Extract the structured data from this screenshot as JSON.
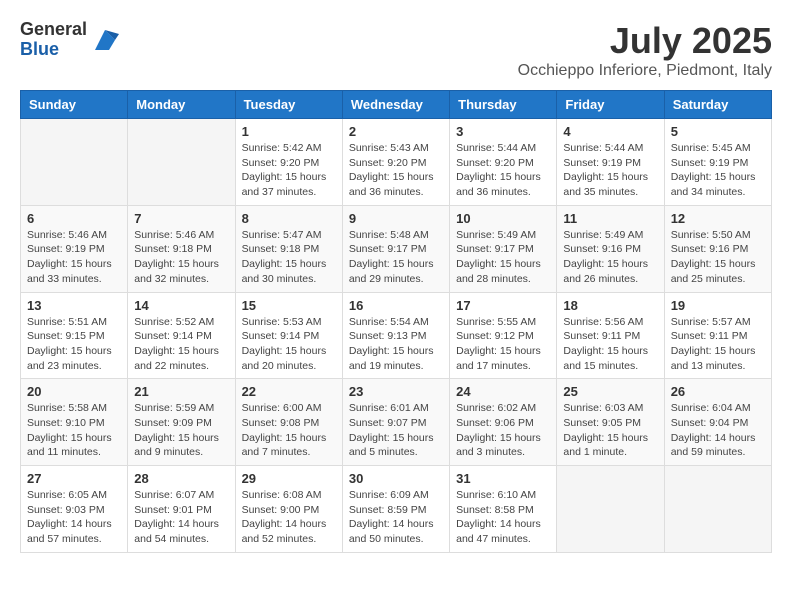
{
  "header": {
    "logo": {
      "general": "General",
      "blue": "Blue"
    },
    "title": "July 2025",
    "location": "Occhieppo Inferiore, Piedmont, Italy"
  },
  "calendar": {
    "days_of_week": [
      "Sunday",
      "Monday",
      "Tuesday",
      "Wednesday",
      "Thursday",
      "Friday",
      "Saturday"
    ],
    "weeks": [
      [
        {
          "day": "",
          "info": ""
        },
        {
          "day": "",
          "info": ""
        },
        {
          "day": "1",
          "info": "Sunrise: 5:42 AM\nSunset: 9:20 PM\nDaylight: 15 hours\nand 37 minutes."
        },
        {
          "day": "2",
          "info": "Sunrise: 5:43 AM\nSunset: 9:20 PM\nDaylight: 15 hours\nand 36 minutes."
        },
        {
          "day": "3",
          "info": "Sunrise: 5:44 AM\nSunset: 9:20 PM\nDaylight: 15 hours\nand 36 minutes."
        },
        {
          "day": "4",
          "info": "Sunrise: 5:44 AM\nSunset: 9:19 PM\nDaylight: 15 hours\nand 35 minutes."
        },
        {
          "day": "5",
          "info": "Sunrise: 5:45 AM\nSunset: 9:19 PM\nDaylight: 15 hours\nand 34 minutes."
        }
      ],
      [
        {
          "day": "6",
          "info": "Sunrise: 5:46 AM\nSunset: 9:19 PM\nDaylight: 15 hours\nand 33 minutes."
        },
        {
          "day": "7",
          "info": "Sunrise: 5:46 AM\nSunset: 9:18 PM\nDaylight: 15 hours\nand 32 minutes."
        },
        {
          "day": "8",
          "info": "Sunrise: 5:47 AM\nSunset: 9:18 PM\nDaylight: 15 hours\nand 30 minutes."
        },
        {
          "day": "9",
          "info": "Sunrise: 5:48 AM\nSunset: 9:17 PM\nDaylight: 15 hours\nand 29 minutes."
        },
        {
          "day": "10",
          "info": "Sunrise: 5:49 AM\nSunset: 9:17 PM\nDaylight: 15 hours\nand 28 minutes."
        },
        {
          "day": "11",
          "info": "Sunrise: 5:49 AM\nSunset: 9:16 PM\nDaylight: 15 hours\nand 26 minutes."
        },
        {
          "day": "12",
          "info": "Sunrise: 5:50 AM\nSunset: 9:16 PM\nDaylight: 15 hours\nand 25 minutes."
        }
      ],
      [
        {
          "day": "13",
          "info": "Sunrise: 5:51 AM\nSunset: 9:15 PM\nDaylight: 15 hours\nand 23 minutes."
        },
        {
          "day": "14",
          "info": "Sunrise: 5:52 AM\nSunset: 9:14 PM\nDaylight: 15 hours\nand 22 minutes."
        },
        {
          "day": "15",
          "info": "Sunrise: 5:53 AM\nSunset: 9:14 PM\nDaylight: 15 hours\nand 20 minutes."
        },
        {
          "day": "16",
          "info": "Sunrise: 5:54 AM\nSunset: 9:13 PM\nDaylight: 15 hours\nand 19 minutes."
        },
        {
          "day": "17",
          "info": "Sunrise: 5:55 AM\nSunset: 9:12 PM\nDaylight: 15 hours\nand 17 minutes."
        },
        {
          "day": "18",
          "info": "Sunrise: 5:56 AM\nSunset: 9:11 PM\nDaylight: 15 hours\nand 15 minutes."
        },
        {
          "day": "19",
          "info": "Sunrise: 5:57 AM\nSunset: 9:11 PM\nDaylight: 15 hours\nand 13 minutes."
        }
      ],
      [
        {
          "day": "20",
          "info": "Sunrise: 5:58 AM\nSunset: 9:10 PM\nDaylight: 15 hours\nand 11 minutes."
        },
        {
          "day": "21",
          "info": "Sunrise: 5:59 AM\nSunset: 9:09 PM\nDaylight: 15 hours\nand 9 minutes."
        },
        {
          "day": "22",
          "info": "Sunrise: 6:00 AM\nSunset: 9:08 PM\nDaylight: 15 hours\nand 7 minutes."
        },
        {
          "day": "23",
          "info": "Sunrise: 6:01 AM\nSunset: 9:07 PM\nDaylight: 15 hours\nand 5 minutes."
        },
        {
          "day": "24",
          "info": "Sunrise: 6:02 AM\nSunset: 9:06 PM\nDaylight: 15 hours\nand 3 minutes."
        },
        {
          "day": "25",
          "info": "Sunrise: 6:03 AM\nSunset: 9:05 PM\nDaylight: 15 hours\nand 1 minute."
        },
        {
          "day": "26",
          "info": "Sunrise: 6:04 AM\nSunset: 9:04 PM\nDaylight: 14 hours\nand 59 minutes."
        }
      ],
      [
        {
          "day": "27",
          "info": "Sunrise: 6:05 AM\nSunset: 9:03 PM\nDaylight: 14 hours\nand 57 minutes."
        },
        {
          "day": "28",
          "info": "Sunrise: 6:07 AM\nSunset: 9:01 PM\nDaylight: 14 hours\nand 54 minutes."
        },
        {
          "day": "29",
          "info": "Sunrise: 6:08 AM\nSunset: 9:00 PM\nDaylight: 14 hours\nand 52 minutes."
        },
        {
          "day": "30",
          "info": "Sunrise: 6:09 AM\nSunset: 8:59 PM\nDaylight: 14 hours\nand 50 minutes."
        },
        {
          "day": "31",
          "info": "Sunrise: 6:10 AM\nSunset: 8:58 PM\nDaylight: 14 hours\nand 47 minutes."
        },
        {
          "day": "",
          "info": ""
        },
        {
          "day": "",
          "info": ""
        }
      ]
    ]
  }
}
